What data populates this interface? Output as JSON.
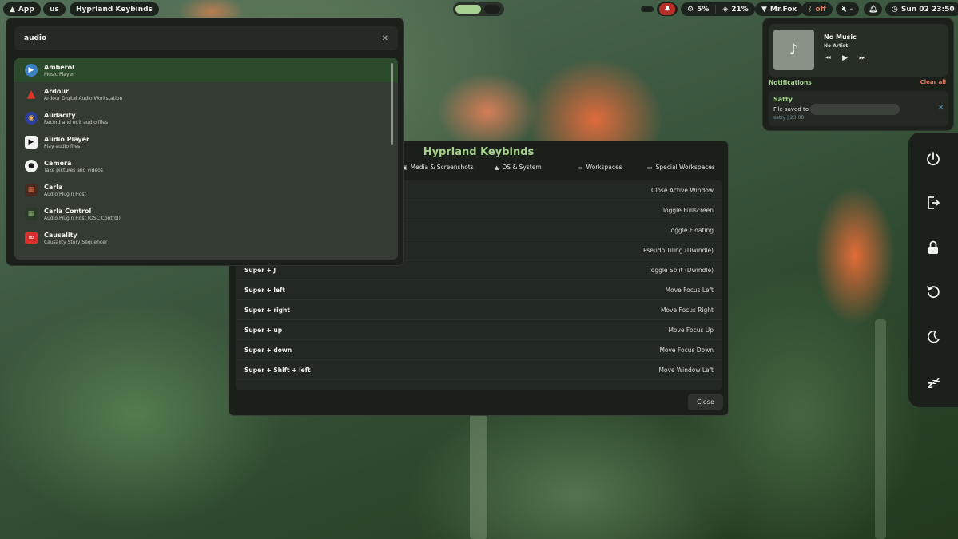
{
  "topbar": {
    "app_label": "App",
    "layout_label": "us",
    "window_title": "Hyprland Keybinds",
    "cpu": "5%",
    "memory": "21%",
    "network": "Mr.Fox",
    "bluetooth": "off",
    "clock": "Sun 02 23:50"
  },
  "launcher": {
    "query": "audio",
    "results": [
      {
        "name": "Amberol",
        "desc": "Music Player",
        "icon": "amberol-icon",
        "color": "#3b82c4"
      },
      {
        "name": "Ardour",
        "desc": "Ardour Digital Audio Workstation",
        "icon": "ardour-icon",
        "color": "#d9362c"
      },
      {
        "name": "Audacity",
        "desc": "Record and edit audio files",
        "icon": "audacity-icon",
        "color": "#2b3e9a"
      },
      {
        "name": "Audio Player",
        "desc": "Play audio files",
        "icon": "audio-player-icon",
        "color": "#111111"
      },
      {
        "name": "Camera",
        "desc": "Take pictures and videos",
        "icon": "camera-icon",
        "color": "#1a1a1a"
      },
      {
        "name": "Carla",
        "desc": "Audio Plugin Host",
        "icon": "carla-icon",
        "color": "#4a2a1f"
      },
      {
        "name": "Carla Control",
        "desc": "Audio Plugin Host (OSC Control)",
        "icon": "carla-control-icon",
        "color": "#2b3a2a"
      },
      {
        "name": "Causality",
        "desc": "Causality Story Sequencer",
        "icon": "causality-icon",
        "color": "#d8302f"
      }
    ]
  },
  "keybinds": {
    "title": "Hyprland Keybinds",
    "tabs": [
      "Media & Screenshots",
      "OS & System",
      "Workspaces",
      "Special Workspaces"
    ],
    "rows": [
      {
        "keys": "",
        "action": "Close Active Window"
      },
      {
        "keys": "",
        "action": "Toggle Fullscreen"
      },
      {
        "keys": "",
        "action": "Toggle Floating"
      },
      {
        "keys": "",
        "action": "Pseudo Tiling (Dwindle)"
      },
      {
        "keys": "Super + J",
        "action": "Toggle Split (Dwindle)"
      },
      {
        "keys": "Super + left",
        "action": "Move Focus Left"
      },
      {
        "keys": "Super + right",
        "action": "Move Focus Right"
      },
      {
        "keys": "Super + up",
        "action": "Move Focus Up"
      },
      {
        "keys": "Super + down",
        "action": "Move Focus Down"
      },
      {
        "keys": "Super + Shift + left",
        "action": "Move Window Left"
      }
    ],
    "close_label": "Close"
  },
  "media": {
    "title": "No Music",
    "artist": "No Artist"
  },
  "notifications": {
    "header": "Notifications",
    "clear_label": "Clear all",
    "items": [
      {
        "app": "Satty",
        "body": "File saved to",
        "meta": "satty | 23:08"
      }
    ]
  },
  "colors": {
    "accent": "#a6d08f",
    "danger": "#e07a5f",
    "panel": "#1b201b"
  }
}
